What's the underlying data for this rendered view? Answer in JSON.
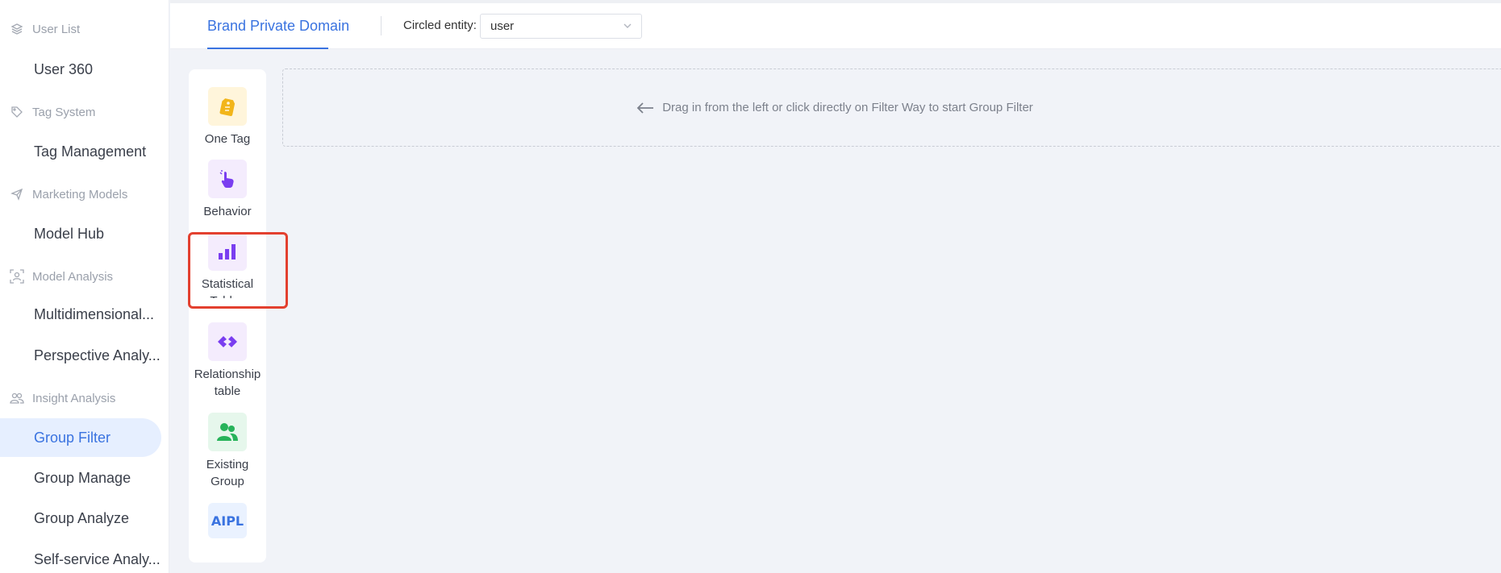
{
  "sidebar": {
    "groups": [
      {
        "title": "User List",
        "icon": "layers-icon",
        "items": [
          "User 360"
        ]
      },
      {
        "title": "Tag System",
        "icon": "tag-icon",
        "items": [
          "Tag Management"
        ]
      },
      {
        "title": "Marketing Models",
        "icon": "send-icon",
        "items": [
          "Model Hub"
        ]
      },
      {
        "title": "Model Analysis",
        "icon": "scan-user-icon",
        "items": [
          "Multidimensional...",
          "Perspective Analy..."
        ]
      },
      {
        "title": "Insight Analysis",
        "icon": "users-icon",
        "items": [
          "Group Filter",
          "Group Manage",
          "Group Analyze",
          "Self-service Analy..."
        ]
      }
    ],
    "active_item": "Group Filter"
  },
  "header": {
    "tab_label": "Brand Private Domain",
    "entity_label": "Circled entity:",
    "entity_value": "user"
  },
  "palette": {
    "items": [
      {
        "label": "One Tag",
        "icon": "tag-icon",
        "bg": "#fff5db",
        "color": "#f2b51a"
      },
      {
        "label": "Behavior",
        "icon": "pointer-hand-icon",
        "bg": "#f4ecfd",
        "color": "#7a3ef0"
      },
      {
        "label": "Statistical Tables",
        "icon": "bar-chart-icon",
        "bg": "#f4ecfd",
        "color": "#7a3ef0"
      },
      {
        "label": "Relationship table",
        "icon": "link-icon",
        "bg": "#f4ecfd",
        "color": "#7a3ef0"
      },
      {
        "label": "Existing Group",
        "icon": "group-icon",
        "bg": "#e6f7ec",
        "color": "#27b35a"
      },
      {
        "label": "AIPL",
        "icon": "aipl-logo",
        "bg": "#eaf2ff",
        "color": "#3a73e0"
      }
    ],
    "highlighted": "Statistical Tables"
  },
  "dropzone": {
    "hint": "Drag in from the left or click directly on Filter Way to start Group Filter"
  },
  "colors": {
    "accent": "#3a73e0",
    "highlight_border": "#e3402f",
    "background": "#f1f3f8"
  }
}
